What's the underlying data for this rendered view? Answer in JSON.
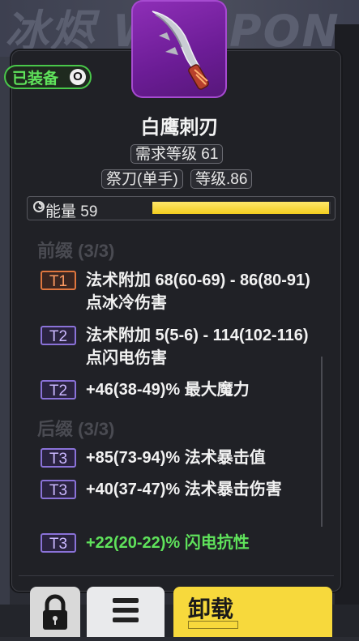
{
  "background": {
    "banner_text": "冰烬 WEAPON"
  },
  "equipped_badge": {
    "label": "已装备",
    "icon": "circle-o-icon",
    "icon_glyph": "O"
  },
  "item": {
    "name": "白鹰刺刃",
    "icon": "curved-dagger-icon",
    "required_level": "需求等级 61",
    "type": "祭刀(单手)",
    "item_level": "等级.86"
  },
  "energy": {
    "icon": "swirl-icon",
    "label": "能量 59",
    "fill_fraction": 0.99
  },
  "sections": {
    "prefix_title": "前缀 (3/3)",
    "suffix_title": "后缀 (3/3)"
  },
  "prefixes": [
    {
      "tier": "T1",
      "text": "法术附加 68(60-69) - 86(80-91) 点冰冷伤害"
    },
    {
      "tier": "T2",
      "text": "法术附加 5(5-6) - 114(102-116) 点闪电伤害"
    },
    {
      "tier": "T2",
      "text": "+46(38-49)% 最大魔力"
    }
  ],
  "suffixes": [
    {
      "tier": "T3",
      "text": "+85(73-94)% 法术暴击值"
    },
    {
      "tier": "T3",
      "text": "+40(37-47)% 法术暴击伤害"
    },
    {
      "tier": "T3",
      "text": "+22(20-22)% 闪电抗性"
    }
  ],
  "actions": {
    "lock_icon": "lock-icon",
    "menu_icon": "menu-icon",
    "unload_label": "卸载"
  },
  "colors": {
    "accent_yellow": "#f7d93c",
    "equipped_green": "#49c84a",
    "t1_orange": "#e0763e",
    "tier_purple": "#8a72d8",
    "item_purple": "#7a24a8"
  }
}
